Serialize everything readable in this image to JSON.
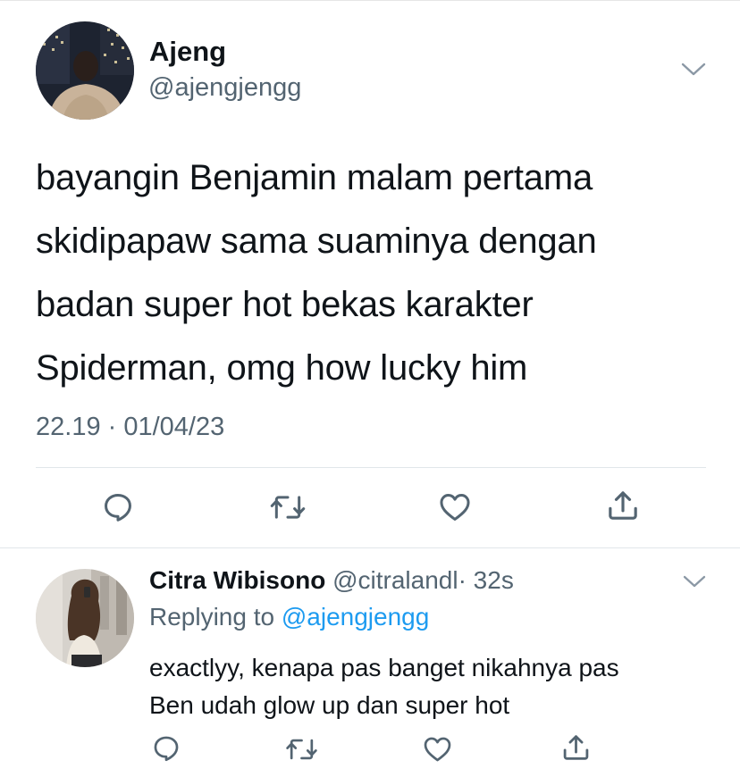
{
  "main_tweet": {
    "author_name": "Ajeng",
    "author_handle": "@ajengjengg",
    "text_lines": [
      "bayangin Benjamin malam pertama",
      "skidipapaw sama suaminya dengan",
      "badan super hot bekas karakter",
      "Spiderman, omg how lucky him"
    ],
    "timestamp": "22.19 · 01/04/23",
    "actions": [
      "reply-icon",
      "retweet-icon",
      "like-icon",
      "share-icon"
    ]
  },
  "reply_tweet": {
    "author_name": "Citra Wibisono",
    "author_handle": "@citralandl",
    "time_ago": "· 32s",
    "replying_prefix": "Replying to",
    "replying_to": "@ajengjengg",
    "text_lines": [
      "exactlyy, kenapa pas banget nikahnya pas",
      "Ben udah glow up dan super hot"
    ],
    "actions": [
      "reply-icon",
      "retweet-icon",
      "like-icon",
      "share-icon"
    ]
  },
  "colors": {
    "primary_text": "#0f1419",
    "secondary_text": "#536471",
    "mention": "#1d9bf0",
    "divider": "#e1e6ea",
    "icon": "#536471"
  }
}
